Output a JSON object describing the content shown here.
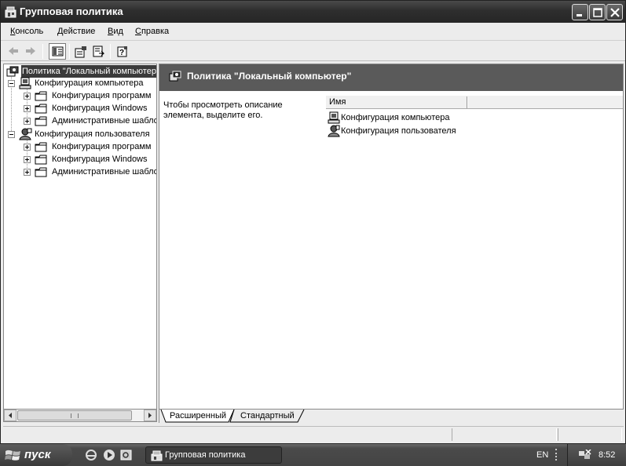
{
  "window": {
    "title": "Групповая политика"
  },
  "menu": {
    "items": [
      {
        "label": "Консоль"
      },
      {
        "label": "Действие"
      },
      {
        "label": "Вид"
      },
      {
        "label": "Справка"
      }
    ]
  },
  "toolbar": {
    "buttons": [
      "back-icon",
      "forward-icon",
      "show-hide-tree-icon",
      "properties-icon",
      "export-list-icon",
      "help-icon"
    ]
  },
  "tree": {
    "root": "Политика \"Локальный компьютер\"",
    "computer": {
      "label": "Конфигурация компьютера",
      "children": [
        {
          "label": "Конфигурация программ"
        },
        {
          "label": "Конфигурация Windows"
        },
        {
          "label": "Административные шаблоны"
        }
      ]
    },
    "user": {
      "label": "Конфигурация пользователя",
      "children": [
        {
          "label": "Конфигурация программ"
        },
        {
          "label": "Конфигурация Windows"
        },
        {
          "label": "Административные шаблоны"
        }
      ]
    }
  },
  "details": {
    "header_title": "Политика \"Локальный компьютер\"",
    "description": "Чтобы просмотреть описание элемента, выделите его.",
    "column_name": "Имя",
    "rows": [
      {
        "name": "Конфигурация компьютера"
      },
      {
        "name": "Конфигурация пользователя"
      }
    ]
  },
  "view_tabs": {
    "extended": "Расширенный",
    "standard": "Стандартный"
  },
  "taskbar": {
    "start_label": "пуск",
    "task_label": "Групповая политика",
    "language": "EN",
    "clock": "8:52"
  }
}
